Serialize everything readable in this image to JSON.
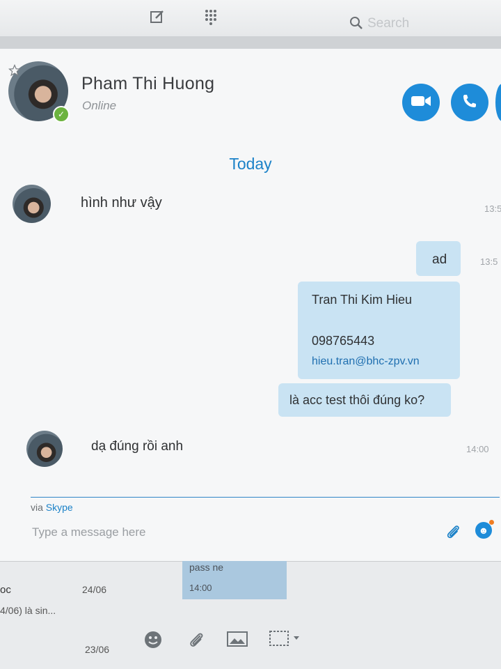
{
  "toolbar": {
    "search_placeholder": "Search"
  },
  "contact": {
    "name": "Pham Thi Huong",
    "status": "Online"
  },
  "conversation": {
    "date_divider": "Today",
    "messages": [
      {
        "direction": "in",
        "text": "hình như vậy",
        "time": "13:5"
      },
      {
        "direction": "out",
        "text": "ad",
        "time": "13:5"
      },
      {
        "direction": "out",
        "type": "contact_card",
        "name": "Tran Thi Kim Hieu",
        "phone": "098765443",
        "email": "hieu.tran@bhc-zpv.vn"
      },
      {
        "direction": "out",
        "text": "là acc test thôi đúng ko?"
      },
      {
        "direction": "in",
        "text": "dạ đúng rồi anh",
        "time": "14:00"
      }
    ]
  },
  "composer": {
    "via_prefix": "via",
    "via_service": "Skype",
    "placeholder": "Type a message here"
  },
  "background_app": {
    "bubble_text": "pass ne",
    "bubble_time": "14:00",
    "row1_name": "oc",
    "row1_date": "24/06",
    "row1_preview": "4/06) là sin...",
    "row2_date": "23/06"
  },
  "colors": {
    "accent": "#1e8cd9",
    "presence_online": "#6cb33f",
    "outgoing_bubble": "#c9e3f3",
    "notification_dot": "#f07d22"
  },
  "icons": [
    "compose-icon",
    "dialpad-icon",
    "search-icon",
    "star-icon",
    "video-camera-icon",
    "phone-icon",
    "paperclip-icon",
    "emoji-icon",
    "image-icon",
    "screenshot-icon"
  ]
}
